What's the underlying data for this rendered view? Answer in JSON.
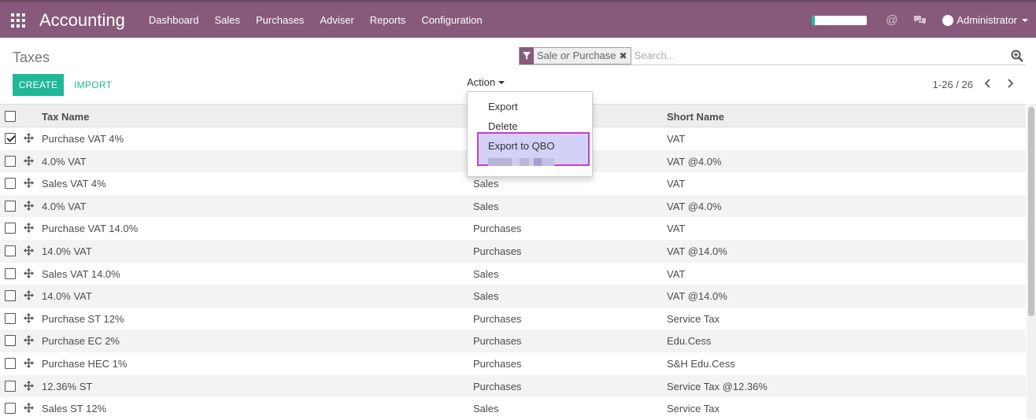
{
  "app": {
    "title": "Accounting"
  },
  "menu": [
    "Dashboard",
    "Sales",
    "Purchases",
    "Adviser",
    "Reports",
    "Configuration"
  ],
  "user": {
    "name": "Administrator"
  },
  "page": {
    "title": "Taxes"
  },
  "search": {
    "facet_part1": "Sale",
    "facet_or": "or",
    "facet_part2": "Purchase",
    "placeholder": "Search..."
  },
  "buttons": {
    "create": "CREATE",
    "import": "IMPORT",
    "action": "Action"
  },
  "pager": {
    "text": "1-26 / 26"
  },
  "action_menu": {
    "export": "Export",
    "delete": "Delete",
    "export_qbo": "Export to QBO"
  },
  "table": {
    "headers": {
      "name": "Tax Name",
      "short": "Short Name"
    },
    "rows": [
      {
        "name": "Purchase VAT 4%",
        "scope": "",
        "short": "VAT",
        "checked": true
      },
      {
        "name": "4.0% VAT",
        "scope": "",
        "short": "VAT @4.0%"
      },
      {
        "name": "Sales VAT 4%",
        "scope": "Sales",
        "short": "VAT"
      },
      {
        "name": "4.0% VAT",
        "scope": "Sales",
        "short": "VAT @4.0%"
      },
      {
        "name": "Purchase VAT 14.0%",
        "scope": "Purchases",
        "short": "VAT"
      },
      {
        "name": "14.0% VAT",
        "scope": "Purchases",
        "short": "VAT @14.0%"
      },
      {
        "name": "Sales VAT 14.0%",
        "scope": "Sales",
        "short": "VAT"
      },
      {
        "name": "14.0% VAT",
        "scope": "Sales",
        "short": "VAT @14.0%"
      },
      {
        "name": "Purchase ST 12%",
        "scope": "Purchases",
        "short": "Service Tax"
      },
      {
        "name": "Purchase EC 2%",
        "scope": "Purchases",
        "short": "Edu.Cess"
      },
      {
        "name": "Purchase HEC 1%",
        "scope": "Purchases",
        "short": "S&H Edu.Cess"
      },
      {
        "name": "12.36% ST",
        "scope": "Purchases",
        "short": "Service Tax @12.36%"
      },
      {
        "name": "Sales ST 12%",
        "scope": "Sales",
        "short": "Service Tax"
      }
    ]
  },
  "colors": {
    "brand": "#875a7b",
    "accent": "#21b799",
    "highlight": "#d4d1f7",
    "highlight_border": "#c83ccf"
  }
}
